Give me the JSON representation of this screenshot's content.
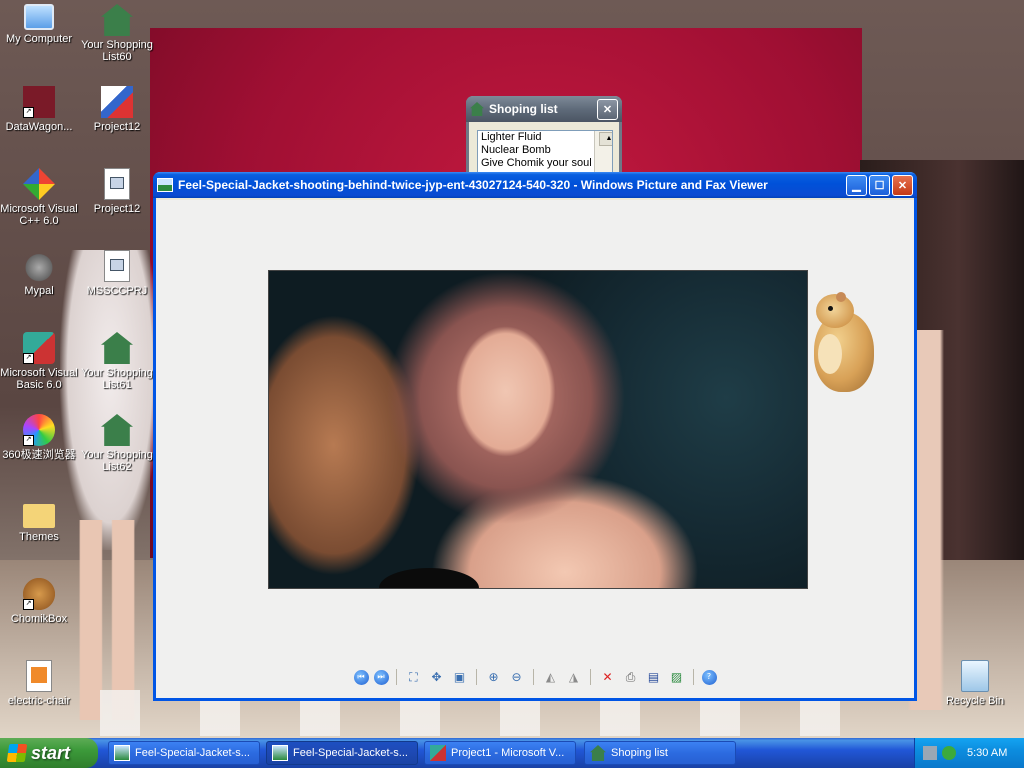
{
  "desktop": {
    "icons": [
      {
        "label": "My Computer"
      },
      {
        "label": "Your Shopping List60"
      },
      {
        "label": "DataWagon..."
      },
      {
        "label": "Project12"
      },
      {
        "label": "Microsoft Visual C++ 6.0"
      },
      {
        "label": "Project12"
      },
      {
        "label": "Mypal"
      },
      {
        "label": "MSSCCPRJ"
      },
      {
        "label": "Microsoft Visual Basic 6.0"
      },
      {
        "label": "Your Shopping List61"
      },
      {
        "label": "360极速浏览器"
      },
      {
        "label": "Your Shopping List62"
      },
      {
        "label": "Themes"
      },
      {
        "label": "ChomikBox"
      },
      {
        "label": "electric-chair"
      },
      {
        "label": "Recycle Bin"
      }
    ]
  },
  "shopping_window": {
    "title": "Shoping list",
    "items": [
      "Lighter Fluid",
      "Nuclear Bomb",
      "Give Chomik your soul"
    ]
  },
  "viewer_window": {
    "title": "Feel-Special-Jacket-shooting-behind-twice-jyp-ent-43027124-540-320 - Windows Picture and Fax Viewer"
  },
  "taskbar": {
    "start_label": "start",
    "tasks": [
      {
        "label": "Feel-Special-Jacket-s..."
      },
      {
        "label": "Feel-Special-Jacket-s..."
      },
      {
        "label": "Project1 - Microsoft V..."
      },
      {
        "label": "Shoping list"
      }
    ],
    "clock": "5:30 AM"
  },
  "colors": {
    "titlebar_active": "#0051d9",
    "titlebar_inactive": "#5f6b7a",
    "start_green": "#3c9a3a",
    "tray_blue": "#0c8ddf"
  }
}
